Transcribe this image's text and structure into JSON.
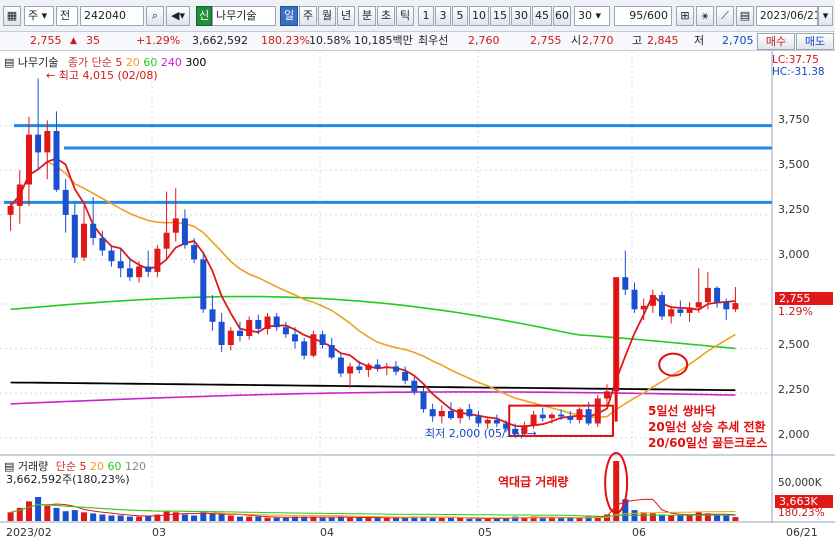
{
  "toolbar": {
    "mode_label": "주",
    "jeon_label": "전",
    "code": "242040",
    "sin_badge": "신",
    "stock_name": "나무기술",
    "periods": [
      "일",
      "주",
      "월",
      "년",
      "분",
      "초",
      "틱"
    ],
    "active_period": "일",
    "intervals": [
      "1",
      "3",
      "5",
      "10",
      "15",
      "30",
      "45",
      "60"
    ],
    "count_value": "30",
    "count_display": "95/600",
    "date": "2023/06/21"
  },
  "quote": {
    "price": "2,755",
    "change_arrow": "▲",
    "change": "35",
    "change_pct": "+1.29%",
    "volume": "3,662,592",
    "volume_pct": "180.23%",
    "turnover": "10.58%",
    "amount": "10,185백만",
    "best_label": "최우선",
    "best_ask": "2,760",
    "best_bid": "2,755",
    "open_label": "시",
    "open": "2,770",
    "high_label": "고",
    "high": "2,845",
    "low_label": "저",
    "low": "2,705",
    "buy_label": "매수",
    "sell_label": "매도"
  },
  "legend": {
    "name": "나무기술",
    "ma_label": "종가 단순",
    "ma_periods": [
      "5",
      "20",
      "60",
      "240",
      "300"
    ],
    "lc": "LC:37.75",
    "hc": "HC:-31.38",
    "high_note": "최고 4,015 (02/08)",
    "low_note": "최저 2,000 (05/16)",
    "vol_label": "거래량",
    "vol_ma_label": "단순",
    "vol_ma_periods": [
      "5",
      "20",
      "60",
      "120"
    ],
    "vol_value": "3,662,592주(180,23%)"
  },
  "annotations": {
    "line1": "5일선 쌍바닥",
    "line2": "20일선 상승 추세 전환",
    "line3": "20/60일선 골든크로스",
    "volume_note": "역대급 거래량"
  },
  "axis": {
    "price_ticks": [
      "3,750",
      "3,500",
      "3,250",
      "3,000",
      "2,750",
      "2,500",
      "2,250",
      "2,000"
    ],
    "current_price_tag": "2,755",
    "current_pct": "1.29%",
    "volume_ticks": [
      "50,000K"
    ],
    "current_vol_tag": "3,663K",
    "current_vol_pct": "180.23%",
    "date_labels": [
      "2023/02",
      "03",
      "04",
      "05",
      "06"
    ],
    "end_date": "06/21"
  },
  "colors": {
    "up": "#e01818",
    "down": "#1a4fd0",
    "ma5": "#e01818",
    "ma20": "#f0a020",
    "ma60": "#22cc22",
    "ma240": "#000000",
    "ma300": "#cc22cc",
    "hline": "#1e8ae6"
  },
  "chart_data": {
    "type": "candlestick",
    "y_range": [
      1920,
      3950
    ],
    "horizontal_lines": [
      3750,
      3625,
      3320
    ],
    "candles": [
      {
        "o": 3250,
        "h": 3320,
        "l": 3160,
        "c": 3300
      },
      {
        "o": 3300,
        "h": 3500,
        "l": 3200,
        "c": 3420
      },
      {
        "o": 3420,
        "h": 3800,
        "l": 3300,
        "c": 3700
      },
      {
        "o": 3700,
        "h": 4015,
        "l": 3500,
        "c": 3600
      },
      {
        "o": 3600,
        "h": 3780,
        "l": 3450,
        "c": 3720
      },
      {
        "o": 3720,
        "h": 3830,
        "l": 3380,
        "c": 3390
      },
      {
        "o": 3390,
        "h": 3450,
        "l": 3150,
        "c": 3250
      },
      {
        "o": 3250,
        "h": 3320,
        "l": 2980,
        "c": 3010
      },
      {
        "o": 3010,
        "h": 3300,
        "l": 2990,
        "c": 3200
      },
      {
        "o": 3200,
        "h": 3350,
        "l": 3080,
        "c": 3120
      },
      {
        "o": 3120,
        "h": 3160,
        "l": 3020,
        "c": 3050
      },
      {
        "o": 3050,
        "h": 3080,
        "l": 2960,
        "c": 2990
      },
      {
        "o": 2990,
        "h": 3060,
        "l": 2900,
        "c": 2950
      },
      {
        "o": 2950,
        "h": 3010,
        "l": 2880,
        "c": 2900
      },
      {
        "o": 2900,
        "h": 2990,
        "l": 2870,
        "c": 2960
      },
      {
        "o": 2960,
        "h": 3050,
        "l": 2900,
        "c": 2930
      },
      {
        "o": 2930,
        "h": 3080,
        "l": 2900,
        "c": 3060
      },
      {
        "o": 3060,
        "h": 3380,
        "l": 3000,
        "c": 3150
      },
      {
        "o": 3150,
        "h": 3400,
        "l": 3100,
        "c": 3230
      },
      {
        "o": 3230,
        "h": 3280,
        "l": 3060,
        "c": 3080
      },
      {
        "o": 3080,
        "h": 3120,
        "l": 2980,
        "c": 3000
      },
      {
        "o": 3000,
        "h": 3040,
        "l": 2700,
        "c": 2720
      },
      {
        "o": 2720,
        "h": 2800,
        "l": 2600,
        "c": 2650
      },
      {
        "o": 2650,
        "h": 2700,
        "l": 2480,
        "c": 2520
      },
      {
        "o": 2520,
        "h": 2620,
        "l": 2490,
        "c": 2600
      },
      {
        "o": 2600,
        "h": 2650,
        "l": 2540,
        "c": 2570
      },
      {
        "o": 2570,
        "h": 2680,
        "l": 2550,
        "c": 2660
      },
      {
        "o": 2660,
        "h": 2690,
        "l": 2580,
        "c": 2610
      },
      {
        "o": 2610,
        "h": 2700,
        "l": 2580,
        "c": 2680
      },
      {
        "o": 2680,
        "h": 2700,
        "l": 2600,
        "c": 2620
      },
      {
        "o": 2620,
        "h": 2650,
        "l": 2560,
        "c": 2580
      },
      {
        "o": 2580,
        "h": 2620,
        "l": 2500,
        "c": 2540
      },
      {
        "o": 2540,
        "h": 2560,
        "l": 2440,
        "c": 2460
      },
      {
        "o": 2460,
        "h": 2600,
        "l": 2450,
        "c": 2580
      },
      {
        "o": 2580,
        "h": 2600,
        "l": 2500,
        "c": 2520
      },
      {
        "o": 2520,
        "h": 2560,
        "l": 2440,
        "c": 2450
      },
      {
        "o": 2450,
        "h": 2470,
        "l": 2340,
        "c": 2360
      },
      {
        "o": 2360,
        "h": 2420,
        "l": 2280,
        "c": 2400
      },
      {
        "o": 2400,
        "h": 2430,
        "l": 2360,
        "c": 2380
      },
      {
        "o": 2380,
        "h": 2420,
        "l": 2340,
        "c": 2410
      },
      {
        "o": 2410,
        "h": 2440,
        "l": 2370,
        "c": 2390
      },
      {
        "o": 2390,
        "h": 2420,
        "l": 2350,
        "c": 2400
      },
      {
        "o": 2400,
        "h": 2430,
        "l": 2350,
        "c": 2370
      },
      {
        "o": 2370,
        "h": 2400,
        "l": 2300,
        "c": 2320
      },
      {
        "o": 2320,
        "h": 2340,
        "l": 2240,
        "c": 2260
      },
      {
        "o": 2260,
        "h": 2280,
        "l": 2140,
        "c": 2160
      },
      {
        "o": 2160,
        "h": 2190,
        "l": 2090,
        "c": 2120
      },
      {
        "o": 2120,
        "h": 2180,
        "l": 2080,
        "c": 2150
      },
      {
        "o": 2150,
        "h": 2200,
        "l": 2100,
        "c": 2110
      },
      {
        "o": 2110,
        "h": 2170,
        "l": 2080,
        "c": 2160
      },
      {
        "o": 2160,
        "h": 2190,
        "l": 2100,
        "c": 2120
      },
      {
        "o": 2120,
        "h": 2150,
        "l": 2060,
        "c": 2080
      },
      {
        "o": 2080,
        "h": 2120,
        "l": 2050,
        "c": 2100
      },
      {
        "o": 2100,
        "h": 2130,
        "l": 2060,
        "c": 2080
      },
      {
        "o": 2080,
        "h": 2100,
        "l": 2030,
        "c": 2050
      },
      {
        "o": 2050,
        "h": 2080,
        "l": 2000,
        "c": 2020
      },
      {
        "o": 2020,
        "h": 2090,
        "l": 2010,
        "c": 2070
      },
      {
        "o": 2070,
        "h": 2150,
        "l": 2050,
        "c": 2130
      },
      {
        "o": 2130,
        "h": 2170,
        "l": 2090,
        "c": 2110
      },
      {
        "o": 2110,
        "h": 2140,
        "l": 2080,
        "c": 2130
      },
      {
        "o": 2130,
        "h": 2160,
        "l": 2100,
        "c": 2120
      },
      {
        "o": 2120,
        "h": 2150,
        "l": 2080,
        "c": 2100
      },
      {
        "o": 2100,
        "h": 2170,
        "l": 2080,
        "c": 2160
      },
      {
        "o": 2160,
        "h": 2200,
        "l": 2070,
        "c": 2080
      },
      {
        "o": 2080,
        "h": 2240,
        "l": 2060,
        "c": 2220
      },
      {
        "o": 2220,
        "h": 2300,
        "l": 2180,
        "c": 2260
      },
      {
        "o": 2260,
        "h": 2900,
        "l": 2250,
        "c": 2900
      },
      {
        "o": 2900,
        "h": 3050,
        "l": 2800,
        "c": 2830
      },
      {
        "o": 2830,
        "h": 2870,
        "l": 2700,
        "c": 2720
      },
      {
        "o": 2720,
        "h": 2780,
        "l": 2660,
        "c": 2740
      },
      {
        "o": 2740,
        "h": 2830,
        "l": 2700,
        "c": 2800
      },
      {
        "o": 2800,
        "h": 2820,
        "l": 2660,
        "c": 2680
      },
      {
        "o": 2680,
        "h": 2740,
        "l": 2640,
        "c": 2720
      },
      {
        "o": 2720,
        "h": 2770,
        "l": 2680,
        "c": 2700
      },
      {
        "o": 2700,
        "h": 2760,
        "l": 2650,
        "c": 2730
      },
      {
        "o": 2730,
        "h": 2950,
        "l": 2700,
        "c": 2760
      },
      {
        "o": 2760,
        "h": 2930,
        "l": 2720,
        "c": 2840
      },
      {
        "o": 2840,
        "h": 2850,
        "l": 2730,
        "c": 2760
      },
      {
        "o": 2760,
        "h": 2780,
        "l": 2660,
        "c": 2720
      },
      {
        "o": 2720,
        "h": 2845,
        "l": 2705,
        "c": 2755
      }
    ],
    "volumes": [
      8,
      12,
      18,
      22,
      14,
      12,
      9,
      10,
      8,
      7,
      6,
      5,
      5,
      4,
      4,
      5,
      6,
      9,
      8,
      6,
      5,
      8,
      7,
      6,
      5,
      4,
      4,
      4,
      3,
      3,
      3,
      4,
      4,
      4,
      3,
      3,
      4,
      3,
      3,
      3,
      3,
      3,
      3,
      3,
      4,
      4,
      3,
      3,
      3,
      3,
      2,
      2,
      2,
      3,
      3,
      4,
      3,
      4,
      3,
      3,
      3,
      3,
      3,
      4,
      4,
      6,
      55,
      20,
      10,
      8,
      7,
      6,
      5,
      5,
      6,
      8,
      7,
      5,
      5,
      3.6
    ]
  }
}
